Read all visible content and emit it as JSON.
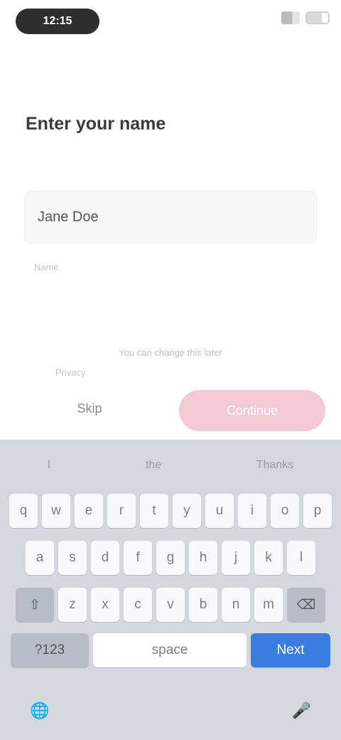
{
  "status": {
    "time": "12:15"
  },
  "form": {
    "heading": "Enter your name",
    "input_value": "Jane Doe",
    "hint": "Name",
    "disclaimer": "You can change this later",
    "disclaimer_sub": "Privacy"
  },
  "buttons": {
    "skip": "Skip",
    "primary": "Continue"
  },
  "keyboard": {
    "suggestions": [
      "I",
      "the",
      "Thanks"
    ],
    "row1": [
      "q",
      "w",
      "e",
      "r",
      "t",
      "y",
      "u",
      "i",
      "o",
      "p"
    ],
    "row2": [
      "a",
      "s",
      "d",
      "f",
      "g",
      "h",
      "j",
      "k",
      "l"
    ],
    "row3": [
      "z",
      "x",
      "c",
      "v",
      "b",
      "n",
      "m"
    ],
    "shift": "⇧",
    "delete": "⌫",
    "symbols": "?123",
    "space": "space",
    "enter": "Next",
    "globe": "🌐",
    "mic": "🎤"
  }
}
